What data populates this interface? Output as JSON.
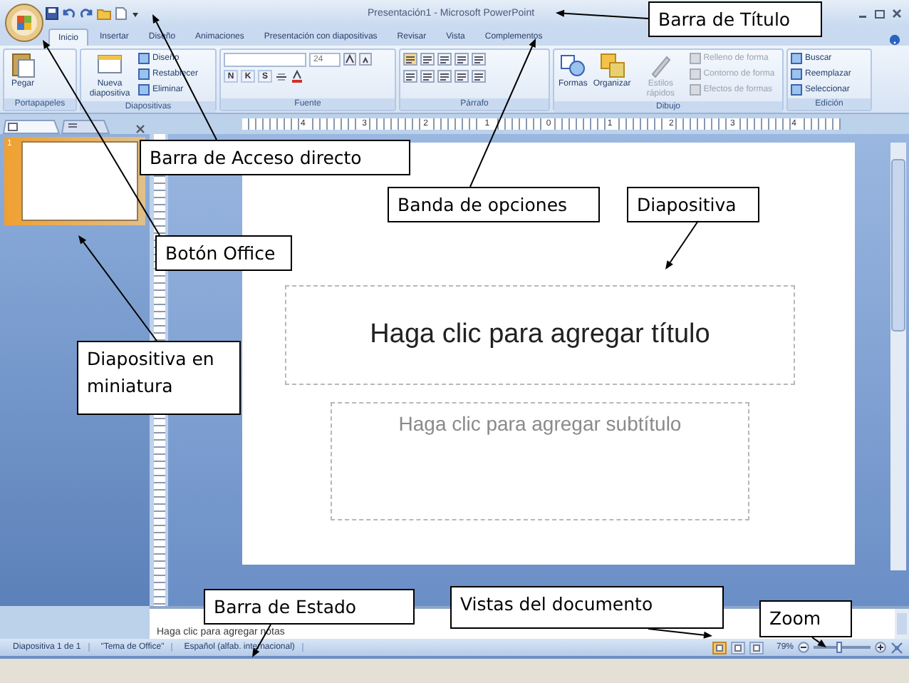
{
  "window": {
    "title": "Presentación1 - Microsoft PowerPoint"
  },
  "tabs": [
    {
      "label": "Inicio",
      "selected": true
    },
    {
      "label": "Insertar",
      "selected": false
    },
    {
      "label": "Diseño",
      "selected": false
    },
    {
      "label": "Animaciones",
      "selected": false
    },
    {
      "label": "Presentación con diapositivas",
      "selected": false
    },
    {
      "label": "Revisar",
      "selected": false
    },
    {
      "label": "Vista",
      "selected": false
    },
    {
      "label": "Complementos",
      "selected": false
    }
  ],
  "ribbon": [
    {
      "label": "Portapapeles",
      "items": [
        {
          "kind": "large",
          "label": "Pegar"
        }
      ]
    },
    {
      "label": "Diapositivas",
      "items": [
        {
          "kind": "large",
          "label": "Nueva diapositiva"
        },
        {
          "kind": "small",
          "label": "Diseño"
        },
        {
          "kind": "small",
          "label": "Restablecer"
        },
        {
          "kind": "small",
          "label": "Eliminar"
        }
      ]
    },
    {
      "label": "Fuente",
      "items": [
        {
          "kind": "fields",
          "value": "24"
        },
        {
          "kind": "letters",
          "letters": [
            "N",
            "K",
            "S"
          ]
        }
      ]
    },
    {
      "label": "Párrafo",
      "items": [
        {
          "kind": "iconrow"
        },
        {
          "kind": "iconrow"
        }
      ]
    },
    {
      "label": "Dibujo",
      "items": [
        {
          "kind": "large",
          "label": "Formas",
          "disabled": false
        },
        {
          "kind": "large",
          "label": "Organizar",
          "disabled": false
        },
        {
          "kind": "large",
          "label": "Estilos rápidos",
          "disabled": true
        },
        {
          "kind": "small",
          "label": "Relleno de forma",
          "disabled": true
        },
        {
          "kind": "small",
          "label": "Contorno de forma",
          "disabled": true
        },
        {
          "kind": "small",
          "label": "Efectos de formas",
          "disabled": true
        }
      ]
    },
    {
      "label": "Edición",
      "items": [
        {
          "kind": "small",
          "label": "Buscar"
        },
        {
          "kind": "small",
          "label": "Reemplazar"
        },
        {
          "kind": "small",
          "label": "Seleccionar"
        }
      ]
    }
  ],
  "ruler": [
    "4",
    "3",
    "2",
    "1",
    "0",
    "1",
    "2",
    "3",
    "4"
  ],
  "thumbnails": [
    {
      "number": "1",
      "selected": true
    }
  ],
  "slide": {
    "title": "Haga clic para agregar título",
    "subtitle": "Haga clic para agregar subtítulo"
  },
  "notes": {
    "placeholder": "Haga clic para agregar notas"
  },
  "status_bar": {
    "items": [
      "Diapositiva 1 de 1",
      "\"Tema de Office\"",
      "Español (alfab. internacional)"
    ],
    "views": [
      {
        "selected": true
      },
      {
        "selected": false
      },
      {
        "selected": false
      }
    ],
    "zoom": "79%",
    "zoom_slider": {
      "level": 0.45
    }
  },
  "callouts": [
    {
      "text": "Barra de Título"
    },
    {
      "text": "Barra de Acceso directo"
    },
    {
      "text": "Banda de opciones"
    },
    {
      "text": "Diapositiva"
    },
    {
      "text": "Botón Office"
    },
    {
      "text": "Diapositiva en miniatura"
    },
    {
      "text": "Barra de Estado"
    },
    {
      "text": "Vistas del documento"
    },
    {
      "text": "Zoom"
    }
  ]
}
